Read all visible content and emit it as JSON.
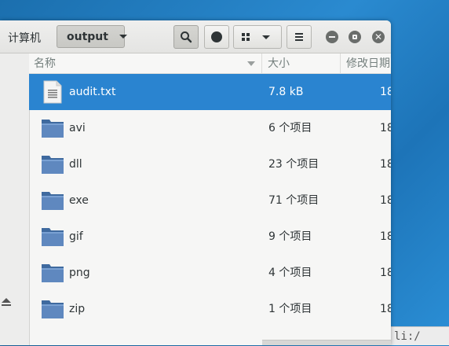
{
  "header": {
    "breadcrumb_computer": "计算机",
    "breadcrumb_current": "output"
  },
  "columns": {
    "name": "名称",
    "size": "大小",
    "date": "修改日期"
  },
  "files": [
    {
      "name": "audit.txt",
      "size": "7.8 kB",
      "date": "18",
      "type": "text-file-icon",
      "selected": true
    },
    {
      "name": "avi",
      "size": "6 个项目",
      "date": "18",
      "type": "folder-icon"
    },
    {
      "name": "dll",
      "size": "23 个项目",
      "date": "18",
      "type": "folder-icon"
    },
    {
      "name": "exe",
      "size": "71 个项目",
      "date": "18",
      "type": "folder-icon"
    },
    {
      "name": "gif",
      "size": "9 个项目",
      "date": "18",
      "type": "folder-icon"
    },
    {
      "name": "png",
      "size": "4 个项目",
      "date": "18",
      "type": "folder-icon"
    },
    {
      "name": "zip",
      "size": "1 个项目",
      "date": "18",
      "type": "folder-icon"
    }
  ],
  "desktop_fragment": "li:/",
  "colors": {
    "selection": "#2a84d0",
    "folder": "#5f88bf"
  }
}
